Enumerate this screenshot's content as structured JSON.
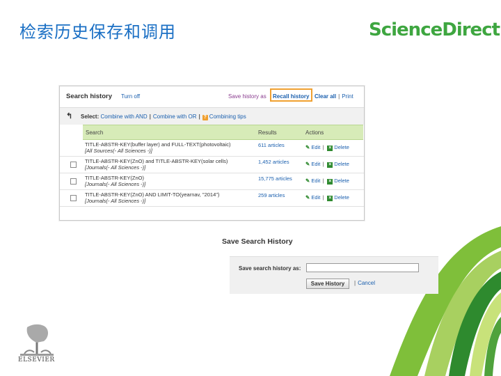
{
  "slide": {
    "title": "检索历史保存和调用",
    "brand": "ScienceDirect"
  },
  "history_panel": {
    "title": "Search history",
    "turn_off": "Turn off",
    "save_history_as": "Save history as",
    "recall_history": "Recall history",
    "clear_all": "Clear all",
    "print": "Print",
    "select_label": "Select:",
    "combine_and": "Combine with AND",
    "combine_or": "Combine with OR",
    "combining_tips": "Combining tips",
    "columns": [
      "Search",
      "Results",
      "Actions"
    ],
    "rows": [
      {
        "q1": "TITLE-ABSTR-KEY(buffer layer) and FULL-TEXT(photovoltaic)",
        "q2": "[All Sources(- All Sciences -)]",
        "results": "611 articles",
        "edit": "Edit",
        "delete": "Delete"
      },
      {
        "q1": "TITLE-ABSTR-KEY(ZnO) and TITLE-ABSTR-KEY(solar cells)",
        "q2": "[Journals(- All Sciences -)]",
        "results": "1,452 articles",
        "edit": "Edit",
        "delete": "Delete"
      },
      {
        "q1": "TITLE-ABSTR-KEY(ZnO)",
        "q2": "[Journals(- All Sciences -)]",
        "results": "15,775 articles",
        "edit": "Edit",
        "delete": "Delete"
      },
      {
        "q1": "TITLE-ABSTR-KEY(ZnO) AND LIMIT-TO(yearnav, \"2014\")",
        "q2": "[Journals(- All Sciences -)]",
        "results": "259 articles",
        "edit": "Edit",
        "delete": "Delete"
      }
    ]
  },
  "save_dialog": {
    "title": "Save Search History",
    "label": "Save search history as:",
    "input_value": "",
    "button": "Save History",
    "cancel": "Cancel"
  },
  "publisher": {
    "name": "ELSEVIER"
  },
  "colors": {
    "title_blue": "#1a6fc4",
    "brand_green": "#3ea640",
    "header_green": "#d7ebb8",
    "highlight_orange": "#f0a030",
    "link_blue": "#1a5fae"
  }
}
